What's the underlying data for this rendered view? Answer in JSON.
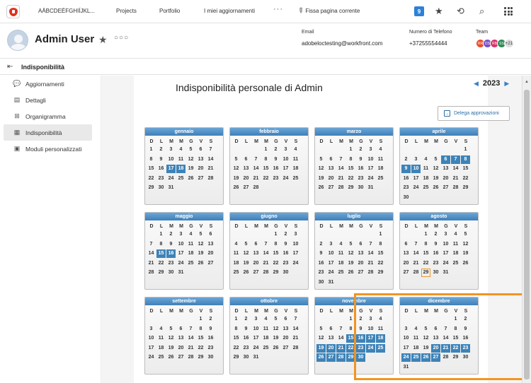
{
  "topnav": {
    "org": "AÄBCDEÉFGHIÍJKL...",
    "links": [
      "Projects",
      "Portfolio",
      "I miei aggiornamenti"
    ],
    "more": "···",
    "pin_label": "Fissa pagina corrente",
    "badge_count": "9"
  },
  "user": {
    "name": "Admin User",
    "email_label": "Email",
    "email": "adobeloctesting@workfront.com",
    "phone_label": "Numero di Telefono",
    "phone": "+37255554444",
    "team_label": "Team",
    "team_avatars": [
      {
        "initials": "RR",
        "color": "#e84d2c"
      },
      {
        "initials": "DS",
        "color": "#7a52c7"
      },
      {
        "initials": "RB",
        "color": "#d6356c"
      },
      {
        "initials": "SS",
        "color": "#2e8b57"
      }
    ],
    "team_more": "+21"
  },
  "section": {
    "title": "Indisponibilità"
  },
  "sidebar": {
    "items": [
      {
        "label": "Aggiornamenti",
        "icon": "chat-bubble-icon",
        "active": false
      },
      {
        "label": "Dettagli",
        "icon": "document-icon",
        "active": false
      },
      {
        "label": "Organigramma",
        "icon": "org-chart-icon",
        "active": false
      },
      {
        "label": "Indisponibilità",
        "icon": "calendar-icon",
        "active": true
      },
      {
        "label": "Moduli personalizzati",
        "icon": "form-icon",
        "active": false
      }
    ]
  },
  "main": {
    "title": "Indisponibilità personale di Admin",
    "year": "2023",
    "delegate_label": "Delega approvazioni"
  },
  "calendar": {
    "weekday_labels": [
      "D",
      "L",
      "M",
      "M",
      "G",
      "V",
      "S"
    ],
    "highlight_color": "#f29422",
    "unavailable_color": "#3d83b8",
    "months": [
      {
        "name": "gennaio",
        "offset": 0,
        "days": 31,
        "unavailable": [
          17,
          18
        ],
        "today": null
      },
      {
        "name": "febbraio",
        "offset": 3,
        "days": 28,
        "unavailable": [],
        "today": null
      },
      {
        "name": "marzo",
        "offset": 3,
        "days": 31,
        "unavailable": [],
        "today": null
      },
      {
        "name": "aprile",
        "offset": 6,
        "days": 30,
        "unavailable": [
          6,
          7,
          8,
          9,
          10
        ],
        "today": null
      },
      {
        "name": "maggio",
        "offset": 1,
        "days": 31,
        "unavailable": [
          15,
          16
        ],
        "today": null
      },
      {
        "name": "giugno",
        "offset": 4,
        "days": 30,
        "unavailable": [],
        "today": null
      },
      {
        "name": "luglio",
        "offset": 6,
        "days": 31,
        "unavailable": [],
        "today": null
      },
      {
        "name": "agosto",
        "offset": 2,
        "days": 31,
        "unavailable": [],
        "today": 29
      },
      {
        "name": "settembre",
        "offset": 5,
        "days": 30,
        "unavailable": [],
        "today": null
      },
      {
        "name": "ottobre",
        "offset": 0,
        "days": 31,
        "unavailable": [],
        "today": null
      },
      {
        "name": "novembre",
        "offset": 3,
        "days": 30,
        "unavailable": [
          15,
          16,
          17,
          18,
          19,
          20,
          21,
          22,
          23,
          24,
          25,
          26,
          27,
          28,
          29,
          30
        ],
        "today": null
      },
      {
        "name": "dicembre",
        "offset": 5,
        "days": 31,
        "unavailable": [
          20,
          21,
          22,
          23,
          24,
          25,
          26,
          27
        ],
        "today": null
      }
    ]
  }
}
